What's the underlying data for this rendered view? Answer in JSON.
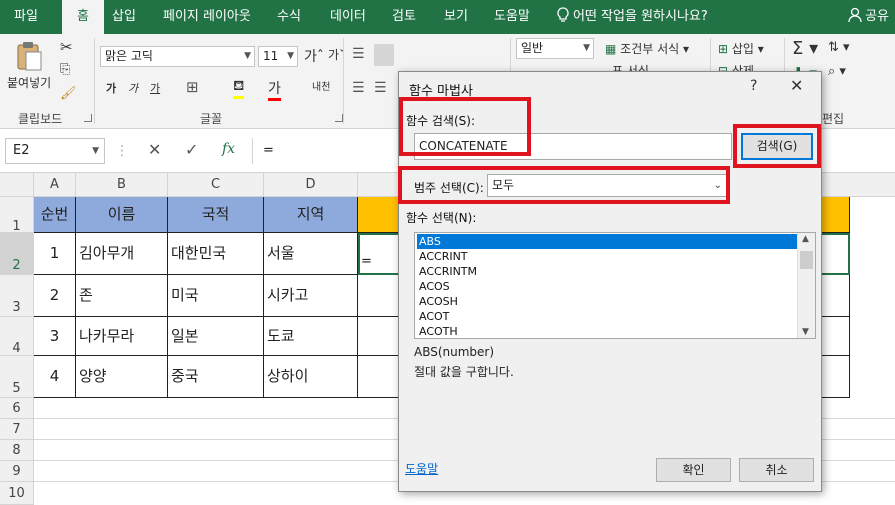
{
  "tabs": [
    "파일",
    "홈",
    "삽입",
    "페이지 레이아웃",
    "수식",
    "데이터",
    "검토",
    "보기",
    "도움말"
  ],
  "active_tab": "홈",
  "tell_me": "어떤 작업을 원하시나요?",
  "share": "공유",
  "ribbon": {
    "clipboard": {
      "paste": "붙여넣기",
      "group_label": "클립보드"
    },
    "font": {
      "font_name": "맑은 고딕",
      "font_size": "11",
      "group_label": "글꼴"
    },
    "number": {
      "format": "일반"
    },
    "styles": {
      "conditional": "조건부 서식",
      "format": "표 서식"
    },
    "cells": {
      "insert": "삽입",
      "delete": "삭제"
    },
    "editing": {
      "group_label": "편집"
    }
  },
  "formula_bar": {
    "name_box": "E2",
    "fx": "fx",
    "content": "="
  },
  "sheet": {
    "columns": [
      "A",
      "B",
      "C",
      "D"
    ],
    "rows": [
      "1",
      "2",
      "3",
      "4",
      "5",
      "6",
      "7",
      "8",
      "9",
      "10"
    ],
    "header": [
      "순번",
      "이름",
      "국적",
      "지역"
    ],
    "data": [
      [
        "1",
        "김아무개",
        "대한민국",
        "서울"
      ],
      [
        "2",
        "존",
        "미국",
        "시카고"
      ],
      [
        "3",
        "나카무라",
        "일본",
        "도쿄"
      ],
      [
        "4",
        "양양",
        "중국",
        "상하이"
      ]
    ],
    "active_value": "="
  },
  "dialog": {
    "title": "함수 마법사",
    "help_btn": "?",
    "close_btn": "✕",
    "search_label": "함수 검색(S):",
    "search_value": "CONCATENATE",
    "search_button": "검색(G)",
    "category_label": "범주 선택(C):",
    "category_value": "모두",
    "function_label": "함수 선택(N):",
    "functions": [
      "ABS",
      "ACCRINT",
      "ACCRINTM",
      "ACOS",
      "ACOSH",
      "ACOT",
      "ACOTH"
    ],
    "selected_function": "ABS",
    "syntax": "ABS(number)",
    "description": "절대 값을 구합니다.",
    "help_link": "도움말",
    "ok": "확인",
    "cancel": "취소"
  },
  "colors": {
    "excel_green": "#217346",
    "header_fill": "#8ea9db",
    "gold_fill": "#ffc000",
    "highlight_red": "#e0141e",
    "selection_blue": "#0078d7"
  }
}
